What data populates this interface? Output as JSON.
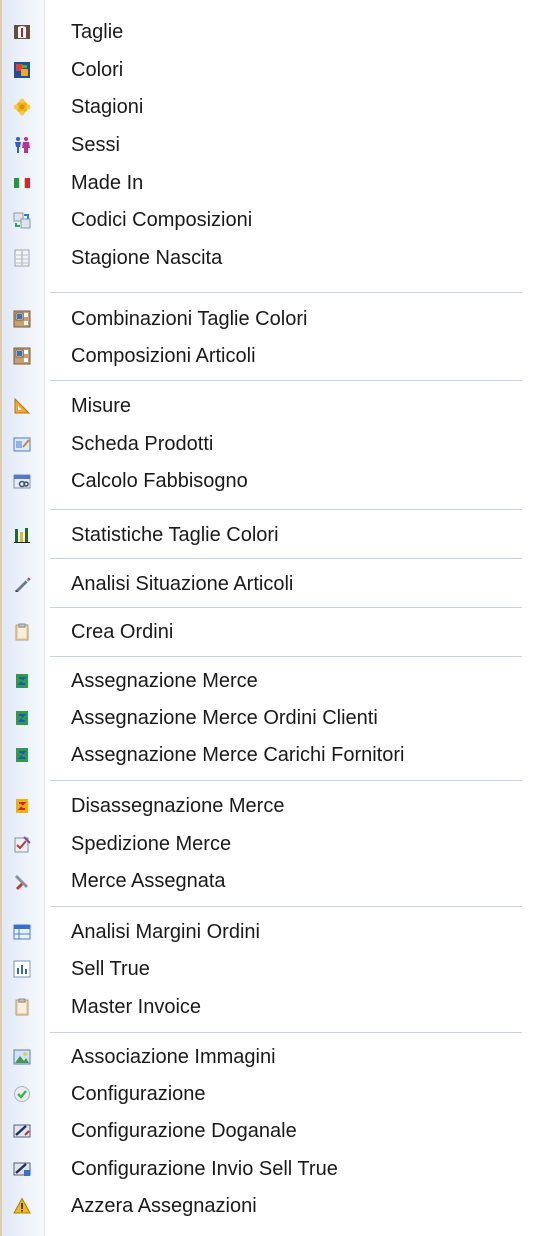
{
  "menu": {
    "items": [
      {
        "label": "Taglie",
        "icon": "sizes-icon"
      },
      {
        "label": "Colori",
        "icon": "colors-icon"
      },
      {
        "label": "Stagioni",
        "icon": "seasons-icon"
      },
      {
        "label": "Sessi",
        "icon": "genders-icon"
      },
      {
        "label": "Made In",
        "icon": "flag-italy-icon"
      },
      {
        "label": "Codici Composizioni",
        "icon": "composition-codes-icon"
      },
      {
        "label": "Stagione Nascita",
        "icon": "calendar-icon"
      },
      {
        "label": "Combinazioni Taglie Colori",
        "icon": "combination-icon"
      },
      {
        "label": "Composizioni Articoli",
        "icon": "combination-icon"
      },
      {
        "label": "Misure",
        "icon": "set-square-icon"
      },
      {
        "label": "Scheda Prodotti",
        "icon": "product-sheet-icon"
      },
      {
        "label": "Calcolo Fabbisogno",
        "icon": "calculator-icon"
      },
      {
        "label": "Statistiche Taglie Colori",
        "icon": "bar-chart-icon"
      },
      {
        "label": "Analisi Situazione Articoli",
        "icon": "pencil-icon"
      },
      {
        "label": "Crea Ordini",
        "icon": "clipboard-icon"
      },
      {
        "label": "Assegnazione Merce",
        "icon": "assign-goods-icon"
      },
      {
        "label": "Assegnazione Merce Ordini Clienti",
        "icon": "assign-goods-icon"
      },
      {
        "label": "Assegnazione Merce Carichi Fornitori",
        "icon": "assign-goods-icon"
      },
      {
        "label": "Disassegnazione Merce",
        "icon": "unassign-goods-icon"
      },
      {
        "label": "Spedizione Merce",
        "icon": "shipping-icon"
      },
      {
        "label": "Merce Assegnata",
        "icon": "tools-icon"
      },
      {
        "label": "Analisi Margini Ordini",
        "icon": "margins-grid-icon"
      },
      {
        "label": "Sell True",
        "icon": "sell-chart-icon"
      },
      {
        "label": "Master Invoice",
        "icon": "clipboard-icon"
      },
      {
        "label": "Associazione Immagini",
        "icon": "image-icon"
      },
      {
        "label": "Configurazione",
        "icon": "check-circle-icon"
      },
      {
        "label": "Configurazione Doganale",
        "icon": "customs-config-icon"
      },
      {
        "label": "Configurazione Invio Sell True",
        "icon": "send-config-icon"
      },
      {
        "label": "Azzera Assegnazioni",
        "icon": "warning-icon"
      }
    ]
  }
}
